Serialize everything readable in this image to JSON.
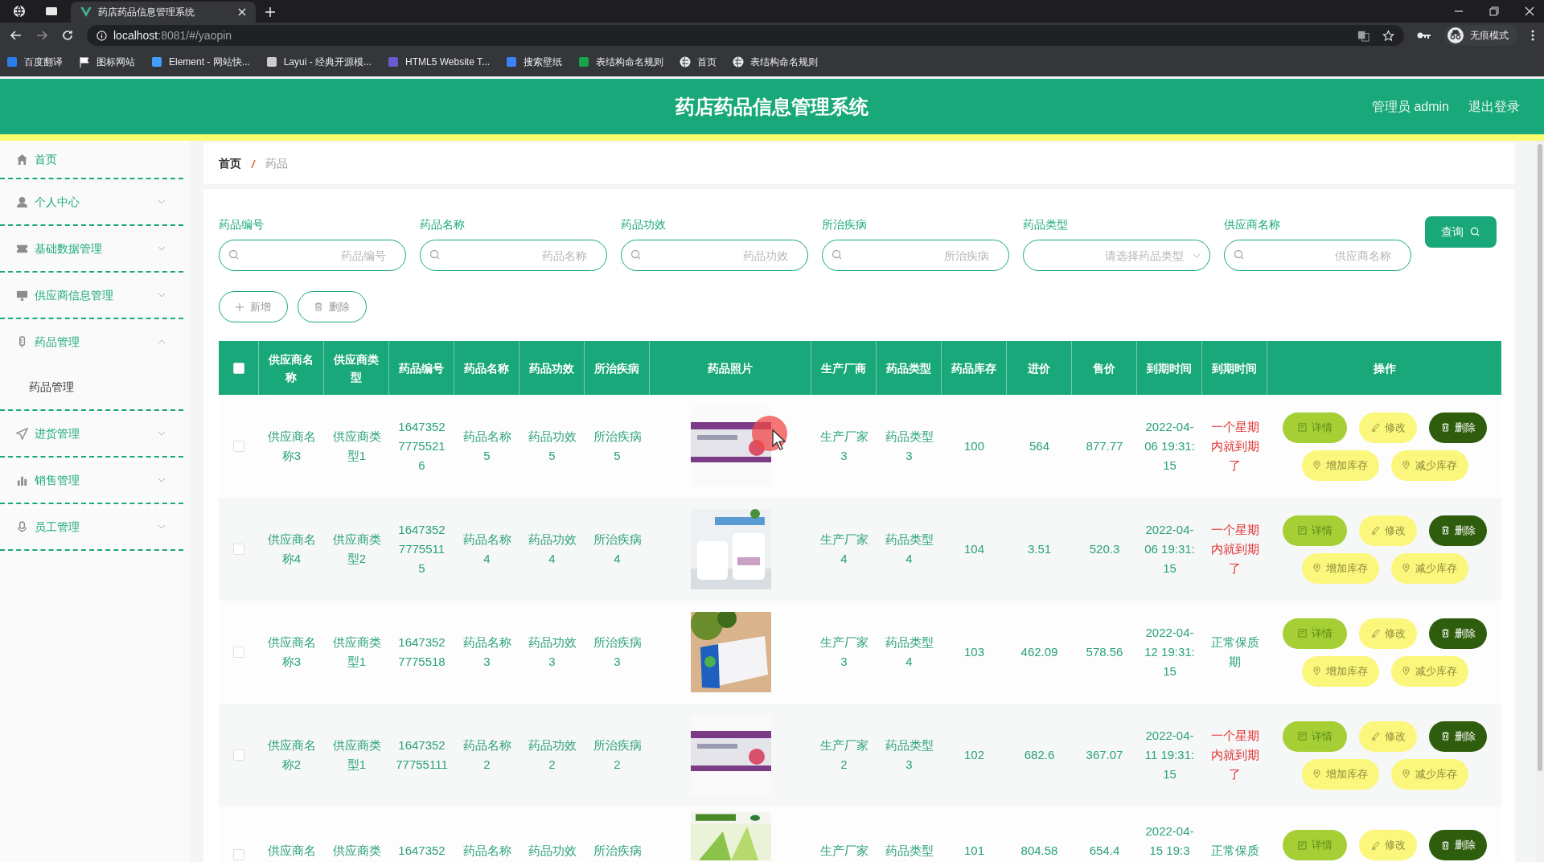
{
  "browser": {
    "tab_title": "药店药品信息管理系统",
    "url_host": "localhost",
    "url_rest": ":8081/#/yaopin",
    "profile": "无痕模式",
    "bookmarks": [
      "百度翻译",
      "图标网站",
      "Element - 网站快...",
      "Layui - 经典开源模...",
      "HTML5 Website T...",
      "搜索壁纸",
      "表结构命名规则",
      "首页",
      "表结构命名规则"
    ]
  },
  "header": {
    "title": "药店药品信息管理系统",
    "user": "管理员 admin",
    "logout": "退出登录"
  },
  "sidebar": {
    "items": [
      {
        "label": "首页",
        "has_arrow": false
      },
      {
        "label": "个人中心",
        "has_arrow": true,
        "expanded": false
      },
      {
        "label": "基础数据管理",
        "has_arrow": true,
        "expanded": false
      },
      {
        "label": "供应商信息管理",
        "has_arrow": true,
        "expanded": false
      },
      {
        "label": "药品管理",
        "has_arrow": true,
        "expanded": true,
        "children": [
          {
            "label": "药品管理"
          }
        ]
      },
      {
        "label": "进货管理",
        "has_arrow": true,
        "expanded": false
      },
      {
        "label": "销售管理",
        "has_arrow": true,
        "expanded": false
      },
      {
        "label": "员工管理",
        "has_arrow": true,
        "expanded": false
      }
    ]
  },
  "breadcrumb": [
    "首页",
    "药品"
  ],
  "filters": [
    {
      "label": "药品编号",
      "placeholder": "药品编号",
      "kind": "text"
    },
    {
      "label": "药品名称",
      "placeholder": "药品名称",
      "kind": "text"
    },
    {
      "label": "药品功效",
      "placeholder": "药品功效",
      "kind": "text"
    },
    {
      "label": "所治疾病",
      "placeholder": "所治疾病",
      "kind": "text"
    },
    {
      "label": "药品类型",
      "placeholder": "请选择药品类型",
      "kind": "select"
    },
    {
      "label": "供应商名称",
      "placeholder": "供应商名称",
      "kind": "text"
    }
  ],
  "query_button": "查询",
  "toolbar": [
    {
      "text": "新增",
      "kind": "add"
    },
    {
      "text": "删除",
      "kind": "delete"
    }
  ],
  "table": {
    "select_all_checked": false,
    "columns": [
      "供应商名称",
      "供应商类型",
      "药品编号",
      "药品名称",
      "药品功效",
      "所治疾病",
      "药品照片",
      "生产厂商",
      "药品类型",
      "药品库存",
      "进价",
      "售价",
      "到期时间",
      "到期时间",
      "操作"
    ],
    "rows": [
      {
        "checked": false,
        "cells": [
          "供应商名称3",
          "供应商类型1",
          "164735277755216",
          "药品名称5",
          "药品功效5",
          "所治疾病5"
        ],
        "photo": {
          "kind": "picture"
        },
        "cells2": [
          "生产厂家3",
          "药品类型3",
          "100",
          "564",
          "877.77",
          "2022-04-06 19:31:15"
        ],
        "status": {
          "text": "一个星期内就到期了",
          "kind": "warning"
        },
        "actions": [
          {
            "text": "详情",
            "kind": "detail"
          },
          {
            "text": "修改",
            "kind": "edit"
          },
          {
            "text": "删除",
            "kind": "delete"
          },
          {
            "text": "增加库存",
            "kind": "stock"
          },
          {
            "text": "减少库存",
            "kind": "stock"
          }
        ]
      },
      {
        "checked": false,
        "cells": [
          "供应商名称4",
          "供应商类型2",
          "164735277755115",
          "药品名称4",
          "药品功效4",
          "所治疾病4"
        ],
        "photo": {
          "kind": "picture"
        },
        "cells2": [
          "生产厂家4",
          "药品类型4",
          "104",
          "3.51",
          "520.3",
          "2022-04-06 19:31:15"
        ],
        "status": {
          "text": "一个星期内就到期了",
          "kind": "warning"
        },
        "actions": [
          {
            "text": "详情",
            "kind": "detail"
          },
          {
            "text": "修改",
            "kind": "edit"
          },
          {
            "text": "删除",
            "kind": "delete"
          },
          {
            "text": "增加库存",
            "kind": "stock"
          },
          {
            "text": "减少库存",
            "kind": "stock"
          }
        ]
      },
      {
        "checked": false,
        "cells": [
          "供应商名称3",
          "供应商类型1",
          "16473527775518",
          "药品名称3",
          "药品功效3",
          "所治疾病3"
        ],
        "photo": {
          "kind": "picture"
        },
        "cells2": [
          "生产厂家3",
          "药品类型4",
          "103",
          "462.09",
          "578.56",
          "2022-04-12 19:31:15"
        ],
        "status": {
          "text": "正常保质期",
          "kind": "normal"
        },
        "actions": [
          {
            "text": "详情",
            "kind": "detail"
          },
          {
            "text": "修改",
            "kind": "edit"
          },
          {
            "text": "删除",
            "kind": "delete"
          },
          {
            "text": "增加库存",
            "kind": "stock"
          },
          {
            "text": "减少库存",
            "kind": "stock"
          }
        ]
      },
      {
        "checked": false,
        "cells": [
          "供应商名称2",
          "供应商类型1",
          "164735277755111",
          "药品名称2",
          "药品功效2",
          "所治疾病2"
        ],
        "photo": {
          "kind": "picture"
        },
        "cells2": [
          "生产厂家2",
          "药品类型3",
          "102",
          "682.6",
          "367.07",
          "2022-04-11 19:31:15"
        ],
        "status": {
          "text": "一个星期内就到期了",
          "kind": "warning"
        },
        "actions": [
          {
            "text": "详情",
            "kind": "detail"
          },
          {
            "text": "修改",
            "kind": "edit"
          },
          {
            "text": "删除",
            "kind": "delete"
          },
          {
            "text": "增加库存",
            "kind": "stock"
          },
          {
            "text": "减少库存",
            "kind": "stock"
          }
        ]
      },
      {
        "checked": false,
        "cells": [
          "供应商名",
          "供应商类",
          "1647352",
          "药品名称",
          "药品功效",
          "所治疾病"
        ],
        "photo": {
          "kind": "picture"
        },
        "cells2": [
          "生产厂家",
          "药品类型",
          "101",
          "804.58",
          "654.4",
          "2022-04-15 19:3"
        ],
        "status": {
          "text": "正常保质",
          "kind": "normal"
        },
        "actions": [
          {
            "text": "详情",
            "kind": "detail"
          },
          {
            "text": "修改",
            "kind": "edit"
          },
          {
            "text": "删除",
            "kind": "delete"
          }
        ]
      }
    ]
  }
}
